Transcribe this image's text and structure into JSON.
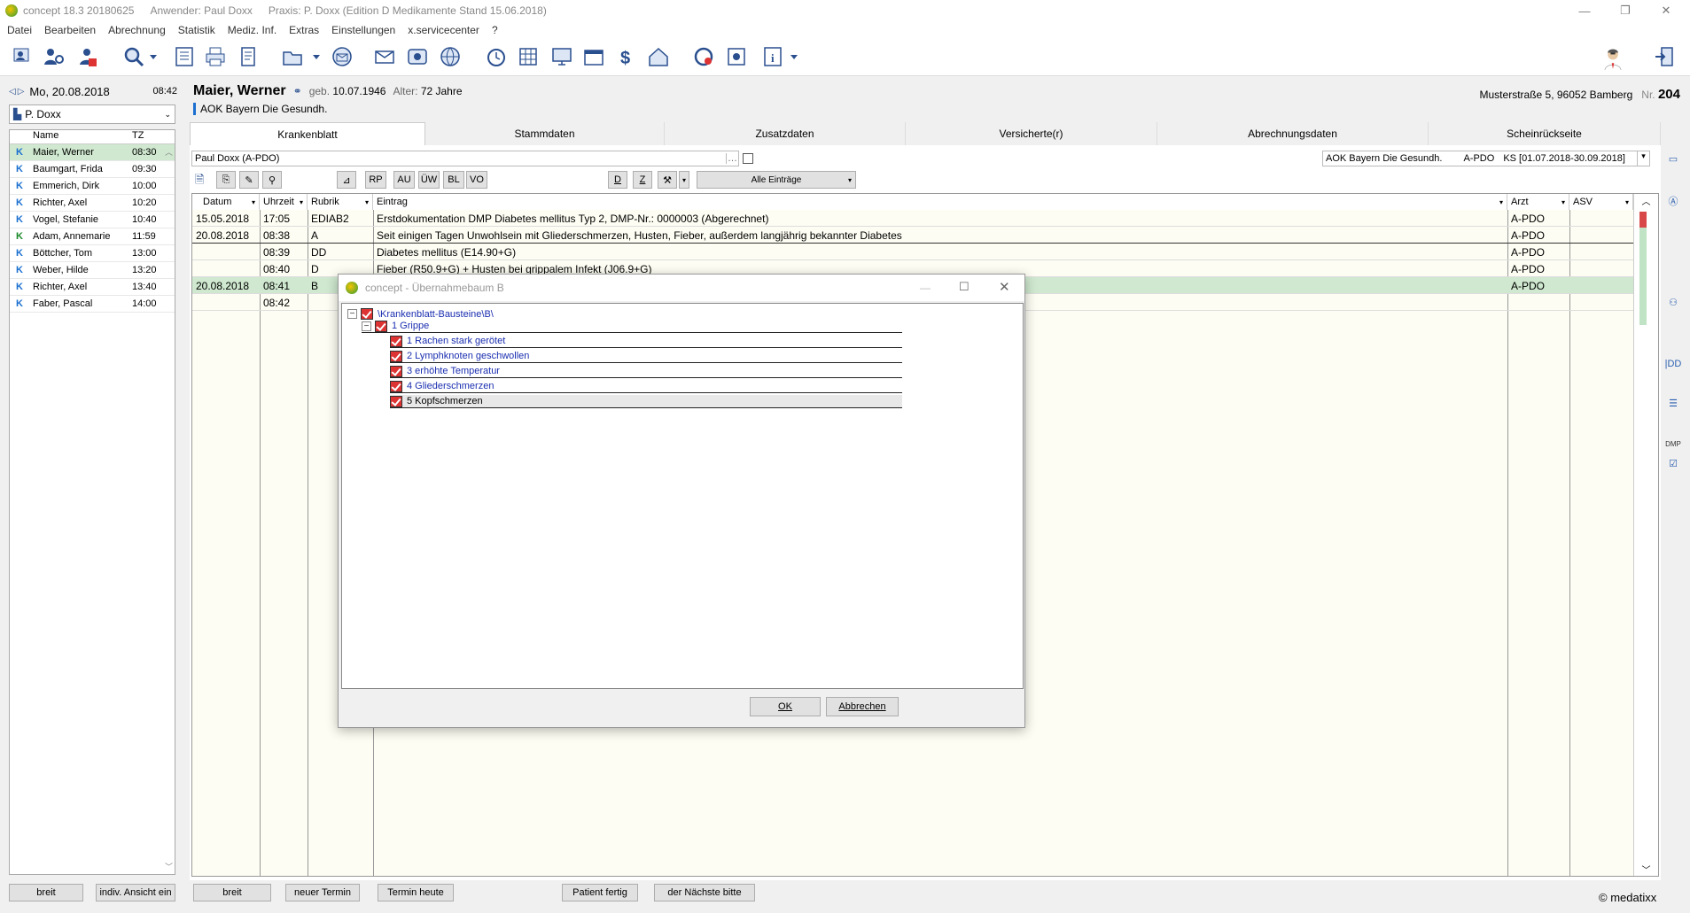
{
  "titlebar": {
    "app": "concept 18.3 20180625",
    "user_label": "Anwender:",
    "user": "Paul Doxx",
    "practice": "Praxis: P. Doxx  (Edition D Medikamente  Stand 15.06.2018)",
    "minimize": "—",
    "restore": "❐",
    "close": "✕"
  },
  "menu": [
    "Datei",
    "Bearbeiten",
    "Abrechnung",
    "Statistik",
    "Mediz. Inf.",
    "Extras",
    "Einstellungen",
    "x.servicecenter",
    "?"
  ],
  "toolbar": {
    "icons": [
      "patient-search-icon",
      "patient-link-icon",
      "patient-add-icon",
      "magnifier-icon",
      "dropdown-icon",
      "list-icon",
      "printer-icon",
      "document-icon",
      "folder-icon",
      "dropdown-icon",
      "mail-icon",
      "envelope-icon",
      "network-icon",
      "globe-icon",
      "clock-icon",
      "calculator-icon",
      "monitor-icon",
      "calendar-icon",
      "dollar-icon",
      "house-icon",
      "refresh-icon",
      "gear-icon",
      "info-icon",
      "dropdown-icon"
    ]
  },
  "left": {
    "date": "Mo, 20.08.2018",
    "time": "08:42",
    "user_select": "P. Doxx",
    "columns": {
      "name": "Name",
      "tz": "TZ"
    },
    "patients": [
      {
        "k": "K",
        "name": "Maier, Werner",
        "time": "08:30",
        "selected": true,
        "green": false
      },
      {
        "k": "K",
        "name": "Baumgart, Frida",
        "time": "09:30",
        "selected": false,
        "green": false
      },
      {
        "k": "K",
        "name": "Emmerich, Dirk",
        "time": "10:00",
        "selected": false,
        "green": false
      },
      {
        "k": "K",
        "name": "Richter, Axel",
        "time": "10:20",
        "selected": false,
        "green": false
      },
      {
        "k": "K",
        "name": "Vogel, Stefanie",
        "time": "10:40",
        "selected": false,
        "green": false
      },
      {
        "k": "K",
        "name": "Adam, Annemarie",
        "time": "11:59",
        "selected": false,
        "green": true
      },
      {
        "k": "K",
        "name": "Böttcher, Tom",
        "time": "13:00",
        "selected": false,
        "green": false
      },
      {
        "k": "K",
        "name": "Weber, Hilde",
        "time": "13:20",
        "selected": false,
        "green": false
      },
      {
        "k": "K",
        "name": "Richter, Axel",
        "time": "13:40",
        "selected": false,
        "green": false
      },
      {
        "k": "K",
        "name": "Faber, Pascal",
        "time": "14:00",
        "selected": false,
        "green": false
      }
    ],
    "btn_breit": "breit",
    "btn_indiv": "indiv. Ansicht ein"
  },
  "patient": {
    "name": "Maier, Werner",
    "dob_label": "geb.",
    "dob": "10.07.1946",
    "age_label": "Alter:",
    "age": "72 Jahre",
    "insurance": "AOK Bayern Die Gesundh.",
    "address": "Musterstraße 5, 96052 Bamberg",
    "nr_label": "Nr.",
    "nr": "204"
  },
  "tabs": [
    "Krankenblatt",
    "Stammdaten",
    "Zusatzdaten",
    "Versicherte(r)",
    "Abrechnungsdaten",
    "Scheinrückseite"
  ],
  "filter": {
    "doctor": "Paul Doxx (A-PDO)",
    "insurance_box": "AOK Bayern Die Gesundh.",
    "apdo": "A-PDO",
    "ks": "KS  [01.07.2018-30.09.2018]",
    "btn_labels": [
      "RP",
      "AU",
      "ÜW",
      "BL",
      "VO"
    ],
    "d_btn": "D",
    "z_btn": "Z",
    "entries_select": "Alle Einträge"
  },
  "grid": {
    "headers": {
      "datum": "Datum",
      "uhrzeit": "Uhrzeit",
      "rubrik": "Rubrik",
      "eintrag": "Eintrag",
      "arzt": "Arzt",
      "asv": "ASV"
    },
    "rows": [
      {
        "datum": "15.05.2018",
        "zeit": "17:05",
        "rubrik": "EDIAB2",
        "eintrag": "Erstdokumentation DMP Diabetes mellitus Typ 2, DMP-Nr.: 0000003 (Abgerechnet)",
        "arzt": "A-PDO",
        "hl": false
      },
      {
        "datum": "20.08.2018",
        "zeit": "08:38",
        "rubrik": "A",
        "eintrag": "Seit einigen Tagen Unwohlsein mit Gliederschmerzen, Husten, Fieber, außerdem langjährig bekannter Diabetes",
        "arzt": "A-PDO",
        "hl": false
      },
      {
        "datum": "",
        "zeit": "08:39",
        "rubrik": "DD",
        "eintrag": "Diabetes mellitus (E14.90+G)",
        "arzt": "A-PDO",
        "hl": false
      },
      {
        "datum": "",
        "zeit": "08:40",
        "rubrik": "D",
        "eintrag": "Fieber (R50.9+G) + Husten bei grippalem Infekt (J06.9+G)",
        "arzt": "A-PDO",
        "hl": false
      },
      {
        "datum": "20.08.2018",
        "zeit": "08:41",
        "rubrik": "B",
        "eintrag": "",
        "arzt": "A-PDO",
        "hl": true
      },
      {
        "datum": "",
        "zeit": "08:42",
        "rubrik": "",
        "eintrag": "",
        "arzt": "",
        "hl": false
      }
    ]
  },
  "dialog": {
    "title": "concept - Übernahmebaum B",
    "root": "\\Krankenblatt-Bausteine\\B\\",
    "group": "1  Grippe",
    "items": [
      "1  Rachen stark gerötet",
      "2  Lymphknoten geschwollen",
      "3  erhöhte Temperatur",
      "4  Gliederschmerzen",
      "5  Kopfschmerzen"
    ],
    "ok": "OK",
    "cancel": "Abbrechen"
  },
  "right_icons": [
    "card-icon",
    "document-a-icon",
    "person-icon",
    "dd-icon",
    "list-icon",
    "dmp-icon",
    "checklist-icon"
  ],
  "bottom": {
    "btn_breit": "breit",
    "btn_neuer_termin": "neuer Termin",
    "btn_termin_heute": "Termin heute",
    "btn_patient_fertig": "Patient fertig",
    "btn_naechste": "der Nächste bitte",
    "copyright": "© medatixx"
  },
  "colors": {
    "selected_row": "#cfe8cf",
    "link_blue": "#1a2eb0",
    "grid_bg": "#fdfdf3"
  }
}
